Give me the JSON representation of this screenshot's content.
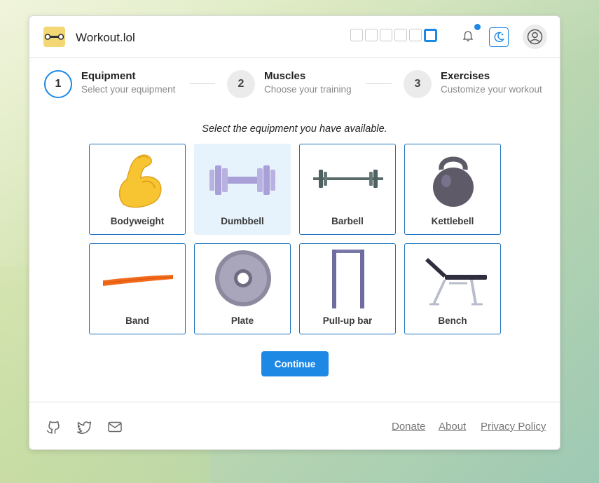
{
  "header": {
    "title": "Workout.lol",
    "logo_icon": "dumbbell-logo-icon",
    "theme_squares": 6,
    "accent": "#1e88e5"
  },
  "stepper": [
    {
      "number": "1",
      "title": "Equipment",
      "subtitle": "Select your equipment",
      "state": "active"
    },
    {
      "number": "2",
      "title": "Muscles",
      "subtitle": "Choose your training",
      "state": "idle"
    },
    {
      "number": "3",
      "title": "Exercises",
      "subtitle": "Customize your workout",
      "state": "idle"
    }
  ],
  "main": {
    "instruction": "Select the equipment you have available.",
    "equipment": [
      {
        "label": "Bodyweight",
        "icon": "flexed-biceps-icon",
        "selected": false
      },
      {
        "label": "Dumbbell",
        "icon": "dumbbell-icon",
        "selected": true
      },
      {
        "label": "Barbell",
        "icon": "barbell-icon",
        "selected": false
      },
      {
        "label": "Kettlebell",
        "icon": "kettlebell-icon",
        "selected": false
      },
      {
        "label": "Band",
        "icon": "resistance-band-icon",
        "selected": false
      },
      {
        "label": "Plate",
        "icon": "weight-plate-icon",
        "selected": false
      },
      {
        "label": "Pull-up bar",
        "icon": "pull-up-bar-icon",
        "selected": false
      },
      {
        "label": "Bench",
        "icon": "bench-icon",
        "selected": false
      }
    ],
    "continue_label": "Continue"
  },
  "footer": {
    "icons": [
      "github-icon",
      "twitter-icon",
      "mail-icon"
    ],
    "links": [
      "Donate",
      "About",
      "Privacy Policy"
    ]
  }
}
